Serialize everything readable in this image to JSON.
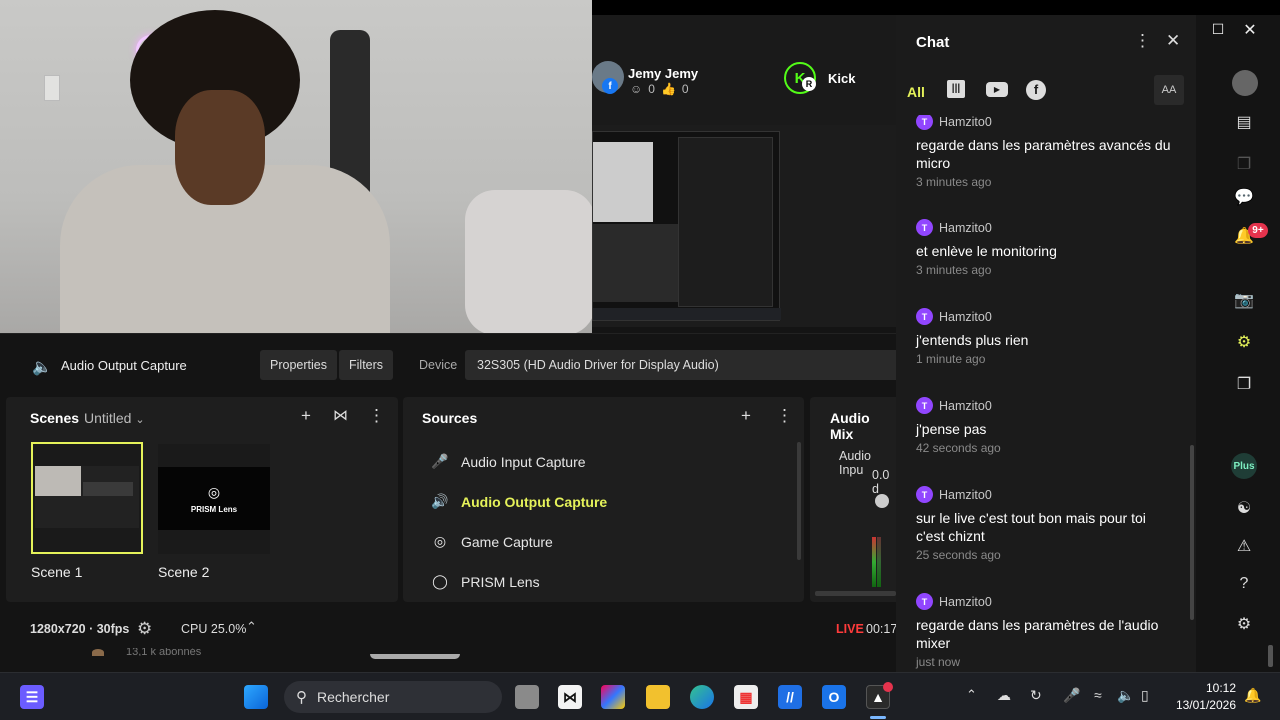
{
  "preview": {
    "channels": [
      {
        "name": "Jemy Jemy",
        "stats_viewers": "0",
        "stats_likes": "0"
      },
      {
        "name": "Kick"
      }
    ]
  },
  "source_bar": {
    "title": "Audio Output Capture",
    "properties_label": "Properties",
    "filters_label": "Filters",
    "device_label": "Device",
    "device_value": "32S305 (HD Audio Driver for Display Audio)"
  },
  "scenes": {
    "title": "Scenes",
    "collection": "Untitled",
    "items": [
      {
        "label": "Scene 1",
        "selected": true
      },
      {
        "label": "Scene 2",
        "selected": false,
        "thumb_text": "PRISM Lens"
      }
    ]
  },
  "sources": {
    "title": "Sources",
    "items": [
      {
        "label": "Audio Input Capture",
        "icon": "mic-icon",
        "active": false
      },
      {
        "label": "Audio Output Capture",
        "icon": "speaker-icon",
        "active": true
      },
      {
        "label": "Game Capture",
        "icon": "gamepad-icon",
        "active": false
      },
      {
        "label": "PRISM Lens",
        "icon": "lens-icon",
        "active": false
      }
    ]
  },
  "mixer": {
    "title": "Audio Mix",
    "channel_label": "Audio Inpu",
    "channel_value": "0.0 d"
  },
  "status": {
    "resolution": "1280x720 · 30fps",
    "cpu": "CPU 25.0%",
    "live_label": "LIVE",
    "live_time": "00:17",
    "behind_text": "13,1 k abonnés"
  },
  "chat": {
    "title": "Chat",
    "tab_all": "All",
    "font_button": "AA",
    "messages": [
      {
        "user": "Hamzito0",
        "text": "regarde dans les paramètres avancés du micro",
        "time": "3 minutes ago"
      },
      {
        "user": "Hamzito0",
        "text": "et enlève le monitoring",
        "time": "3 minutes ago"
      },
      {
        "user": "Hamzito0",
        "text": "j'entends plus rien",
        "time": "1 minute ago"
      },
      {
        "user": "Hamzito0",
        "text": "j'pense pas",
        "time": "42 seconds ago"
      },
      {
        "user": "Hamzito0",
        "text": "sur le live c'est tout bon mais pour toi c'est chiznt",
        "time": "25 seconds ago"
      },
      {
        "user": "Hamzito0",
        "text": "regarde dans les paramètres de l'audio mixer",
        "time": "just now"
      }
    ]
  },
  "rail": {
    "plus_label": "Plus",
    "notif_count": "9+"
  },
  "taskbar": {
    "search_placeholder": "Rechercher",
    "time": "10:12",
    "date": "13/01/2026"
  },
  "colors": {
    "accent": "#e5f25a",
    "twitch": "#9146ff",
    "live": "#ff3b3b"
  }
}
